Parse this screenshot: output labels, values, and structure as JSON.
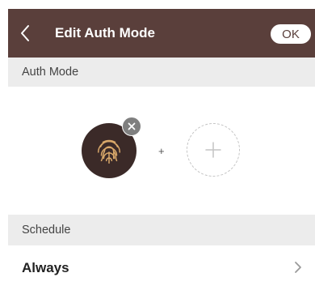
{
  "header": {
    "title": "Edit Auth Mode",
    "ok_label": "OK",
    "back_icon": "chevron-left-icon"
  },
  "auth_mode": {
    "section_label": "Auth Mode",
    "selected_method_icon": "fingerprint-icon",
    "remove_icon": "close-icon",
    "separator": "+",
    "add_icon": "plus-icon"
  },
  "schedule": {
    "section_label": "Schedule",
    "value": "Always",
    "chevron_icon": "chevron-right-icon"
  },
  "colors": {
    "app_bar": "#5a3f3b",
    "fingerprint_bg": "#3b2a28",
    "fingerprint_accent": "#d9a86a",
    "section_bg": "#ececec"
  }
}
